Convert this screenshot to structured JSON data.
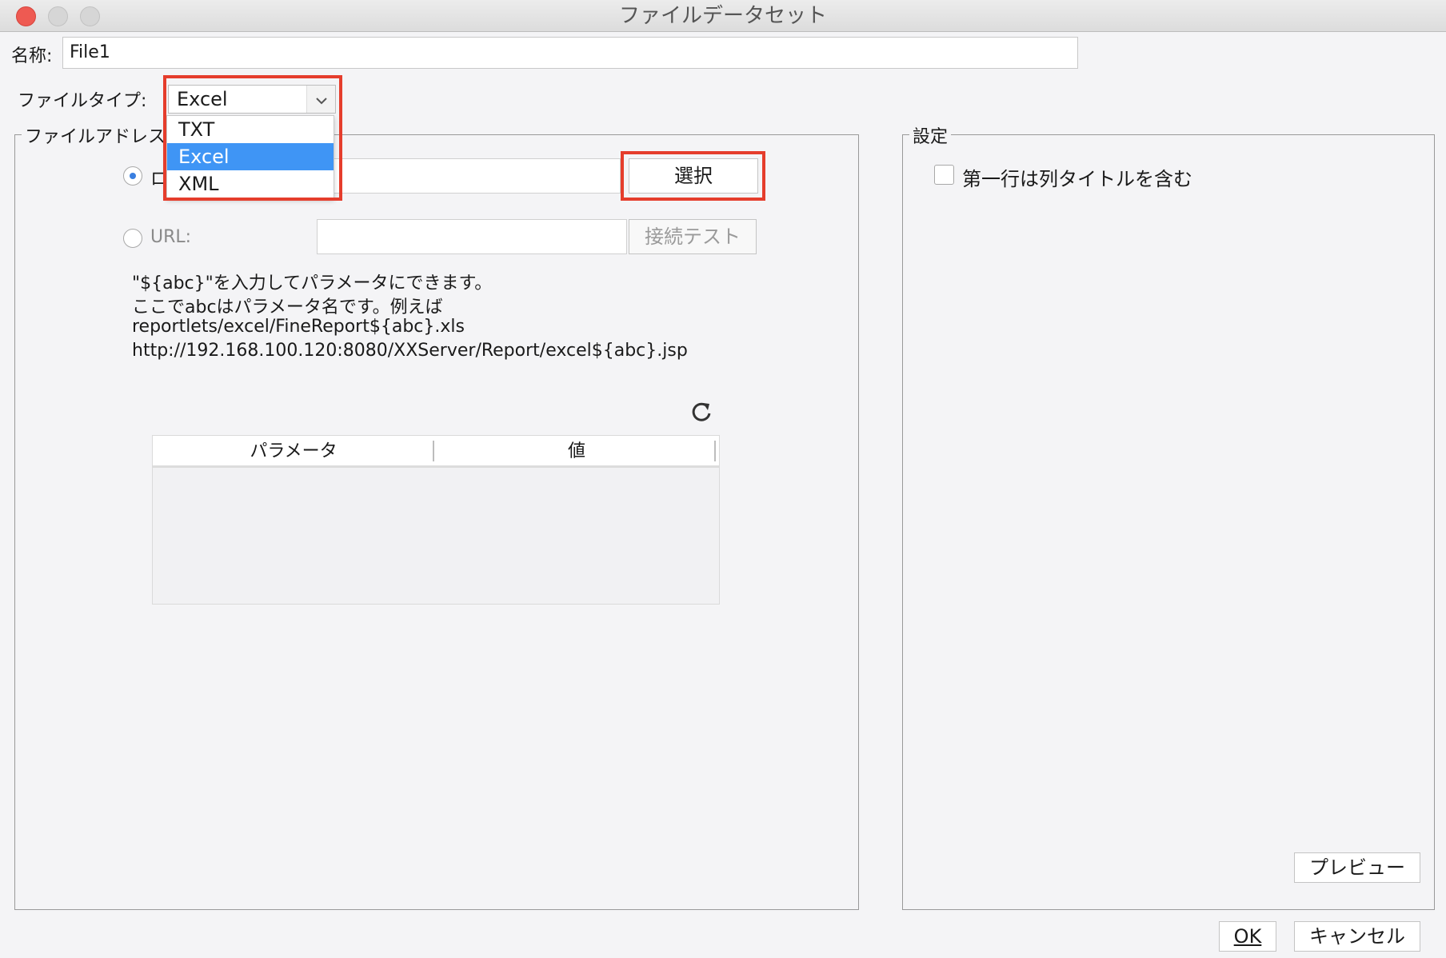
{
  "window": {
    "title": "ファイルデータセット"
  },
  "name": {
    "label": "名称:",
    "value": "File1"
  },
  "file_type": {
    "label": "ファイルタイプ:",
    "selected": "Excel",
    "options": [
      "TXT",
      "Excel",
      "XML"
    ]
  },
  "file_address": {
    "group_title": "ファイルアドレス",
    "local_radio_label": "ロ",
    "select_button": "選択",
    "url_label": "URL:",
    "test_button": "接続テスト",
    "hint_lines": [
      "\"${abc}\"を入力してパラメータにできます。",
      " ここでabcはパラメータ名です。例えば",
      "reportlets/excel/FineReport${abc}.xls",
      "http://192.168.100.120:8080/XXServer/Report/excel${abc}.jsp"
    ],
    "table_headers": [
      "パラメータ",
      "値"
    ]
  },
  "settings": {
    "group_title": "設定",
    "checkbox_label": "第一行は列タイトルを含む",
    "preview_button": "プレビュー"
  },
  "footer": {
    "ok": "OK",
    "cancel": "キャンセル"
  },
  "colors": {
    "highlight": "#e53d2c",
    "selection": "#3f95f5",
    "close": "#ee5a52"
  },
  "icons": {
    "refresh": "refresh-icon",
    "dropdown": "chevron-down-icon"
  }
}
